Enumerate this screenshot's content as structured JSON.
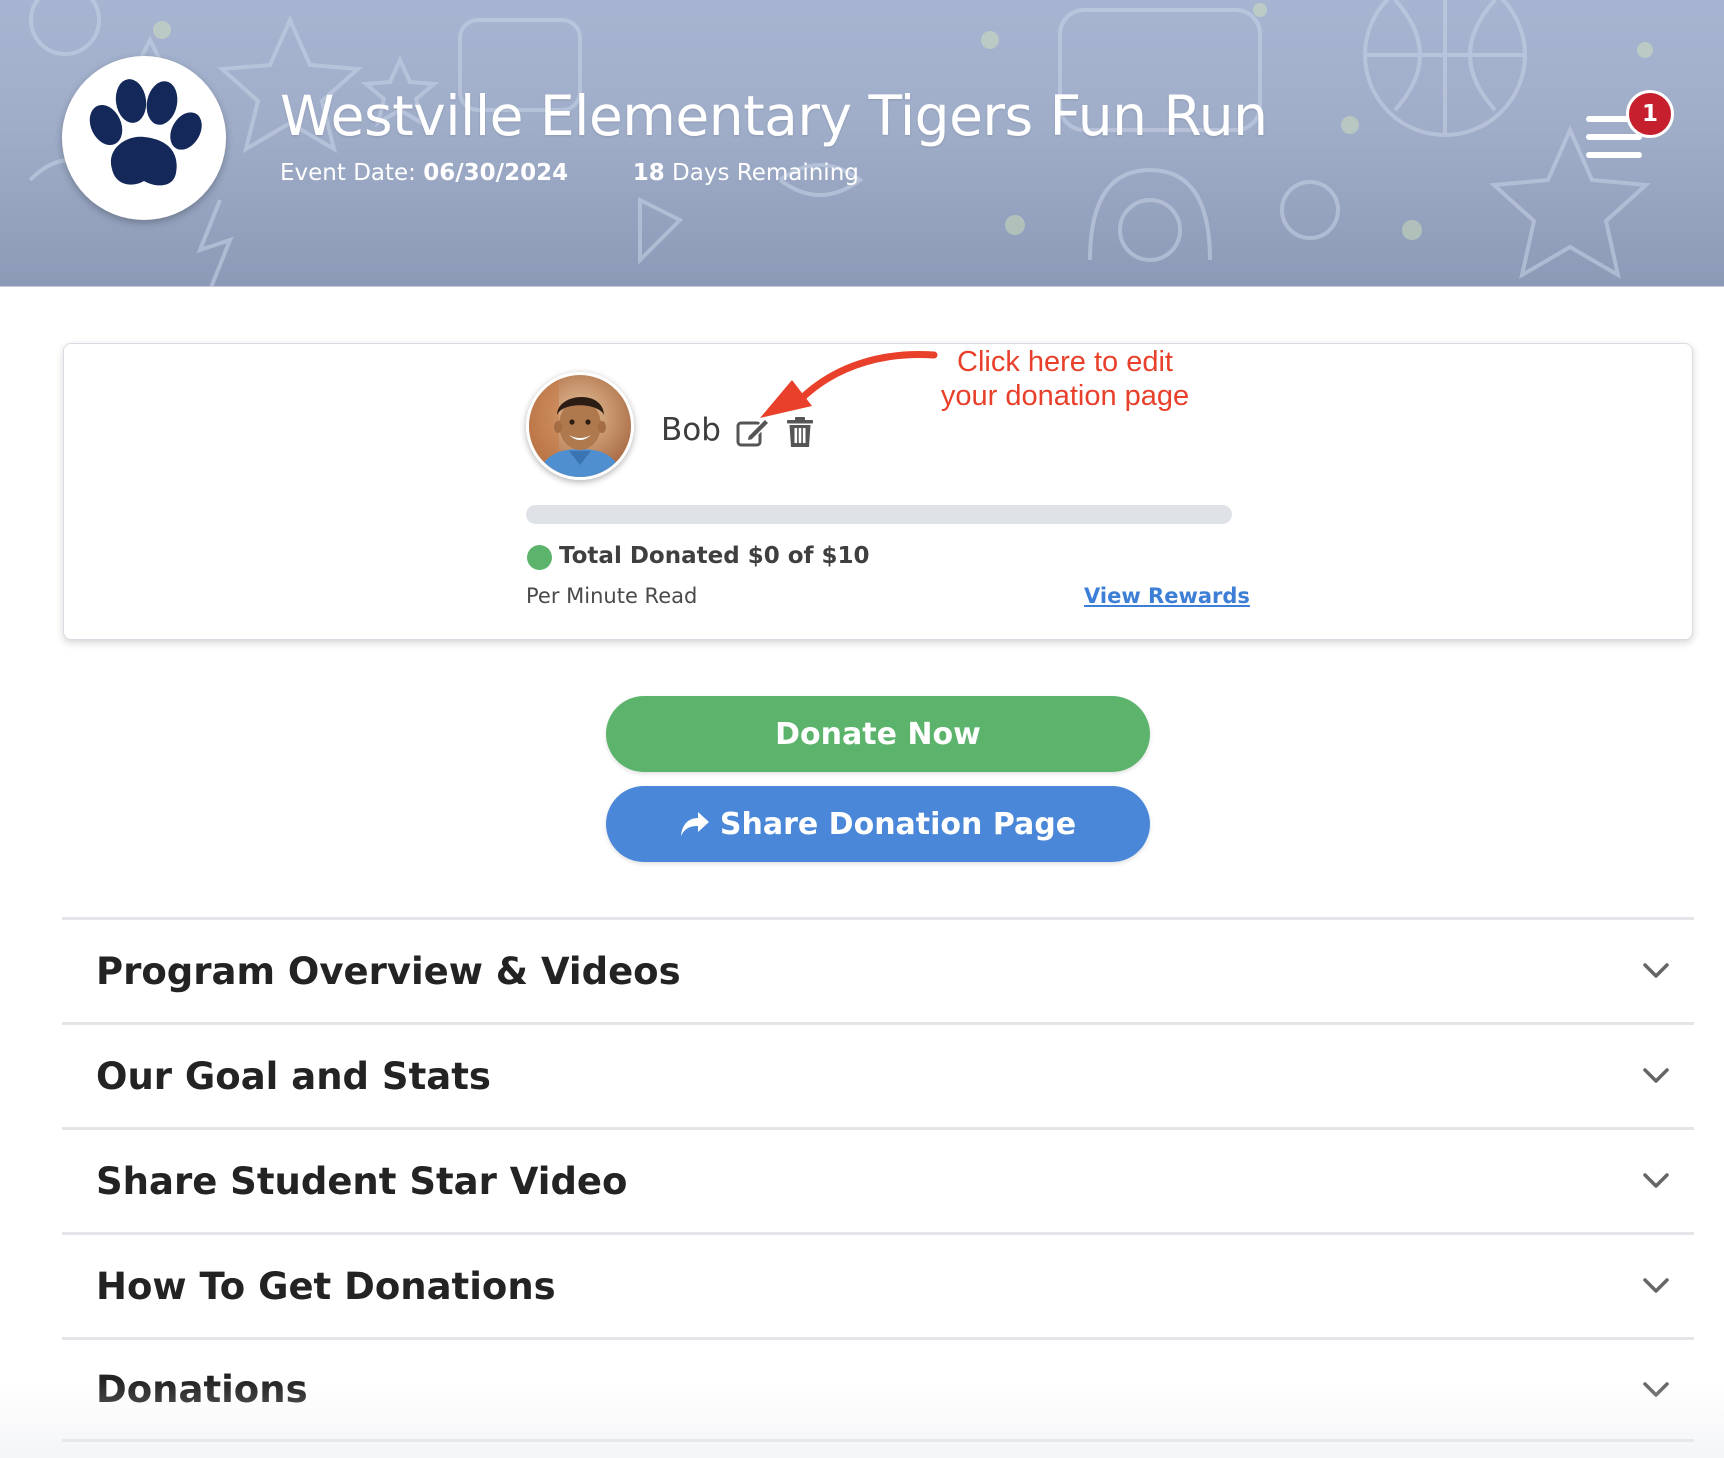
{
  "header": {
    "title": "Westville Elementary Tigers Fun Run",
    "event_date_label": "Event Date:",
    "event_date": "06/30/2024",
    "days_remaining_count": "18",
    "days_remaining_label": "Days Remaining",
    "notification_count": "1",
    "logo_icon": "paw-print-icon",
    "menu_icon": "hamburger-menu-icon"
  },
  "student": {
    "name": "Bob",
    "edit_icon": "edit-icon",
    "delete_icon": "trash-icon",
    "progress_fraction": 0,
    "total_donated_text": "Total Donated $0 of $10",
    "pledge_type": "Per Minute Read",
    "view_rewards_label": "View Rewards"
  },
  "annotation": {
    "line1": "Click here to edit",
    "line2": "your donation page"
  },
  "actions": {
    "donate_label": "Donate Now",
    "share_label": "Share Donation Page",
    "share_icon": "share-arrow-icon"
  },
  "sections": [
    {
      "label": "Program Overview & Videos"
    },
    {
      "label": "Our Goal and Stats"
    },
    {
      "label": "Share Student Star Video"
    },
    {
      "label": "How To Get Donations"
    },
    {
      "label": "Donations"
    }
  ],
  "colors": {
    "green": "#5cb46c",
    "blue": "#4a87d8",
    "badge_red": "#c6202f",
    "annotation_red": "#e8402a",
    "link_blue": "#3d7fd6",
    "paw_navy": "#14285a"
  }
}
